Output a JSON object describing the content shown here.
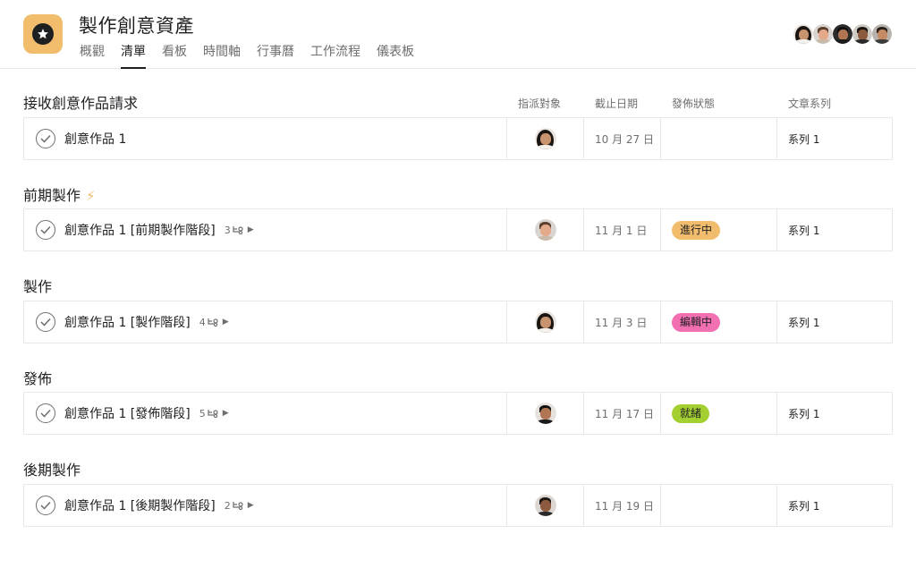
{
  "project": {
    "title": "製作創意資產",
    "icon": "star-icon",
    "icon_color": "#f1bd6c"
  },
  "tabs": [
    {
      "label": "概觀",
      "active": false
    },
    {
      "label": "清單",
      "active": true
    },
    {
      "label": "看板",
      "active": false
    },
    {
      "label": "時間軸",
      "active": false
    },
    {
      "label": "行事曆",
      "active": false
    },
    {
      "label": "工作流程",
      "active": false
    },
    {
      "label": "儀表板",
      "active": false
    }
  ],
  "members": [
    "member-1",
    "member-2",
    "member-3",
    "member-4",
    "member-5"
  ],
  "columns": {
    "assignee": "指派對象",
    "due": "截止日期",
    "status": "發佈狀態",
    "series": "文章系列"
  },
  "sections": [
    {
      "title": "接收創意作品請求",
      "icon": "",
      "task": {
        "name": "創意作品 1",
        "subtasks": "",
        "due": "10 月 27 日",
        "status": "",
        "status_color": "",
        "series": "系列 1",
        "assignee": "woman-long-hair"
      }
    },
    {
      "title": "前期製作",
      "icon": "⚡",
      "task": {
        "name": "創意作品 1 [前期製作階段]",
        "subtasks": "3",
        "due": "11 月 1 日",
        "status": "進行中",
        "status_color": "#f1bd6c",
        "series": "系列 1",
        "assignee": "man-light"
      }
    },
    {
      "title": "製作",
      "icon": "",
      "task": {
        "name": "創意作品 1 [製作階段]",
        "subtasks": "4",
        "due": "11 月 3 日",
        "status": "編輯中",
        "status_color": "#f26fb2",
        "series": "系列 1",
        "assignee": "woman-long-hair"
      }
    },
    {
      "title": "發佈",
      "icon": "",
      "task": {
        "name": "創意作品 1 [發佈階段]",
        "subtasks": "5",
        "due": "11 月 17 日",
        "status": "就緒",
        "status_color": "#a4cf30",
        "series": "系列 1",
        "assignee": "man-dark"
      }
    },
    {
      "title": "後期製作",
      "icon": "",
      "task": {
        "name": "創意作品 1 [後期製作階段]",
        "subtasks": "2",
        "due": "11 月 19 日",
        "status": "",
        "status_color": "",
        "series": "系列 1",
        "assignee": "man-beard"
      }
    }
  ]
}
